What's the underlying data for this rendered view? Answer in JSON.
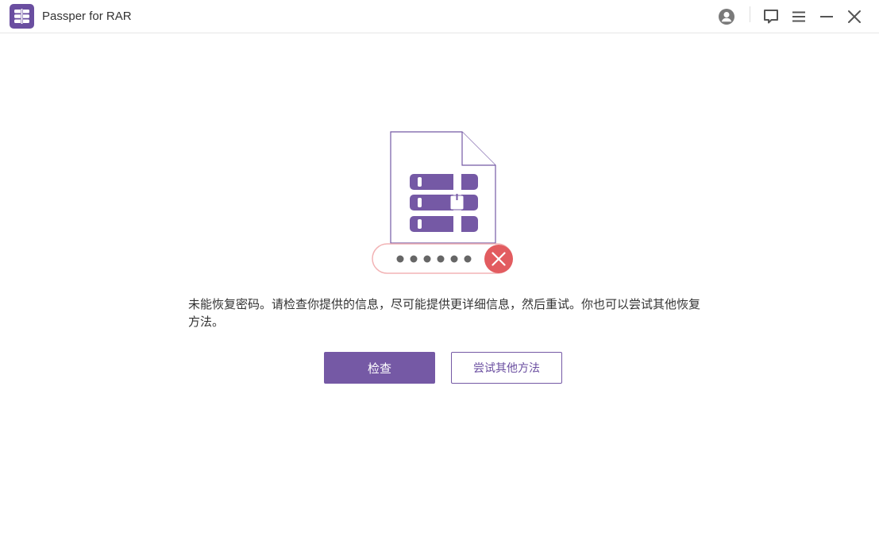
{
  "app": {
    "title": "Passper for RAR"
  },
  "titlebar": {
    "icons": [
      "account-icon",
      "feedback-icon",
      "menu-icon",
      "minimize-icon",
      "close-icon"
    ]
  },
  "illustration": {
    "password_mask": "●●●●●●",
    "status": "error"
  },
  "main": {
    "message": "未能恢复密码。请检查你提供的信息，尽可能提供更详细信息，然后重试。你也可以尝试其他恢复方法。",
    "check_button_label": "检查",
    "try_other_button_label": "尝试其他方法"
  },
  "colors": {
    "accent": "#7559a5",
    "error": "#e25c60",
    "error_light": "#f2b3b5"
  }
}
